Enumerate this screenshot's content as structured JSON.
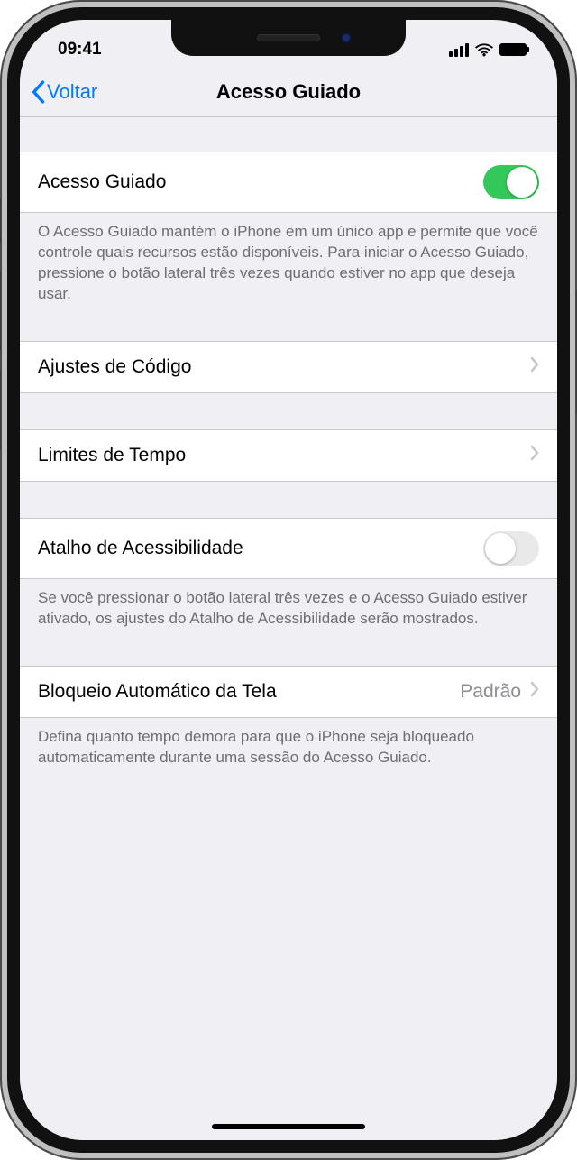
{
  "status": {
    "time": "09:41"
  },
  "nav": {
    "back": "Voltar",
    "title": "Acesso Guiado"
  },
  "section1": {
    "label": "Acesso Guiado",
    "toggle_on": true,
    "footer": "O Acesso Guiado mantém o iPhone em um único app e permite que você controle quais recursos estão disponíveis. Para iniciar o Acesso Guiado, pressione o botão lateral três vezes quando estiver no app que deseja usar."
  },
  "section2": {
    "label": "Ajustes de Código"
  },
  "section3": {
    "label": "Limites de Tempo"
  },
  "section4": {
    "label": "Atalho de Acessibilidade",
    "toggle_on": false,
    "footer": "Se você pressionar o botão lateral três vezes e o Acesso Guiado estiver ativado, os ajustes do Atalho de Acessibilidade serão mostrados."
  },
  "section5": {
    "label": "Bloqueio Automático da Tela",
    "value": "Padrão",
    "footer": "Defina quanto tempo demora para que o iPhone seja bloqueado automaticamente durante uma sessão do Acesso Guiado."
  }
}
